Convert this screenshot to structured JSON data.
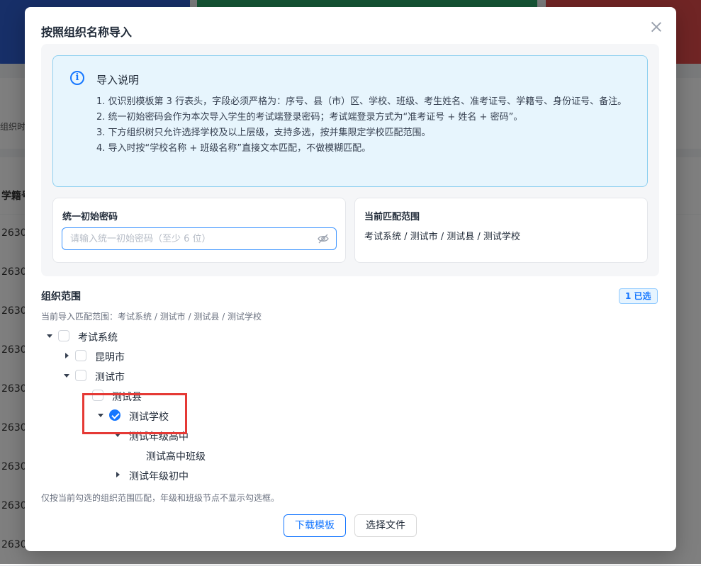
{
  "background": {
    "column_header": "学籍号",
    "filter_label_fragment": "组织时",
    "row_prefix": "2630",
    "row_count": 9
  },
  "modal": {
    "title": "按照组织名称导入",
    "close_label": "×",
    "info": {
      "title": "导入说明",
      "items": [
        "1. 仅识别模板第 3 行表头，字段必须严格为：序号、县（市）区、学校、班级、考生姓名、准考证号、学籍号、身份证号、备注。",
        "2. 统一初始密码会作为本次导入学生的考试端登录密码；考试端登录方式为“准考证号 + 姓名 + 密码”。",
        "3. 下方组织树只允许选择学校及以上层级，支持多选，按并集限定学校匹配范围。",
        "4. 导入时按“学校名称 + 班级名称”直接文本匹配，不做模糊匹配。"
      ]
    },
    "password": {
      "label": "统一初始密码",
      "placeholder": "请输入统一初始密码（至少 6 位）",
      "value": ""
    },
    "current_scope": {
      "label": "当前匹配范围",
      "value": "考试系统 / 测试市 / 测试县 / 测试学校"
    },
    "org": {
      "title": "组织范围",
      "badge": "1 已选",
      "subtitle": "当前导入匹配范围：考试系统 / 测试市 / 测试县 / 测试学校",
      "tree": [
        {
          "label": "考试系统",
          "caret": "down",
          "checkbox": true,
          "checked": false
        },
        {
          "label": "昆明市",
          "caret": "right",
          "checkbox": true,
          "checked": false
        },
        {
          "label": "测试市",
          "caret": "down",
          "checkbox": true,
          "checked": false
        },
        {
          "label": "测试县",
          "caret": "none",
          "checkbox": true,
          "checked": false
        },
        {
          "label": "测试学校",
          "caret": "down",
          "checkbox": true,
          "checked": true
        },
        {
          "label": "测试年级高中",
          "caret": "down",
          "checkbox": false,
          "checked": false
        },
        {
          "label": "测试高中班级",
          "caret": "none",
          "checkbox": false,
          "checked": false
        },
        {
          "label": "测试年级初中",
          "caret": "right",
          "checkbox": false,
          "checked": false
        }
      ],
      "footnote": "仅按当前勾选的组织范围匹配，年级和班级节点不显示勾选框。"
    },
    "buttons": {
      "download": "下载模板",
      "select_file": "选择文件"
    }
  },
  "colors": {
    "primary": "#1677ff",
    "info_bg": "#e7f5fd",
    "highlight": "#e53935"
  }
}
